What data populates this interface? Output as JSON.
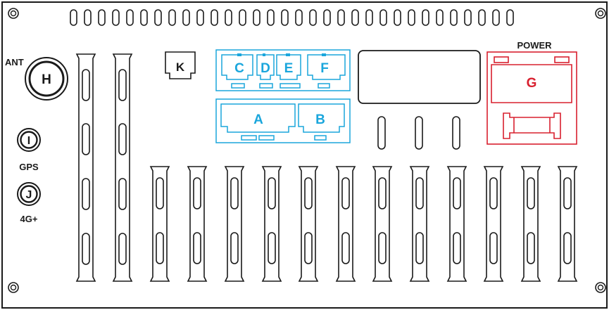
{
  "labels": {
    "ant": "ANT",
    "h": "H",
    "i": "I",
    "gps": "GPS",
    "j": "J",
    "g4": "4G+",
    "k": "K",
    "c": "C",
    "d": "D",
    "e": "E",
    "f": "F",
    "a": "A",
    "b": "B",
    "power": "POWER",
    "g": "G"
  },
  "colors": {
    "outline": "#1a1a1a",
    "connector_blue": "#1aa6dc",
    "power_red": "#d8202f",
    "background": "#ffffff"
  }
}
